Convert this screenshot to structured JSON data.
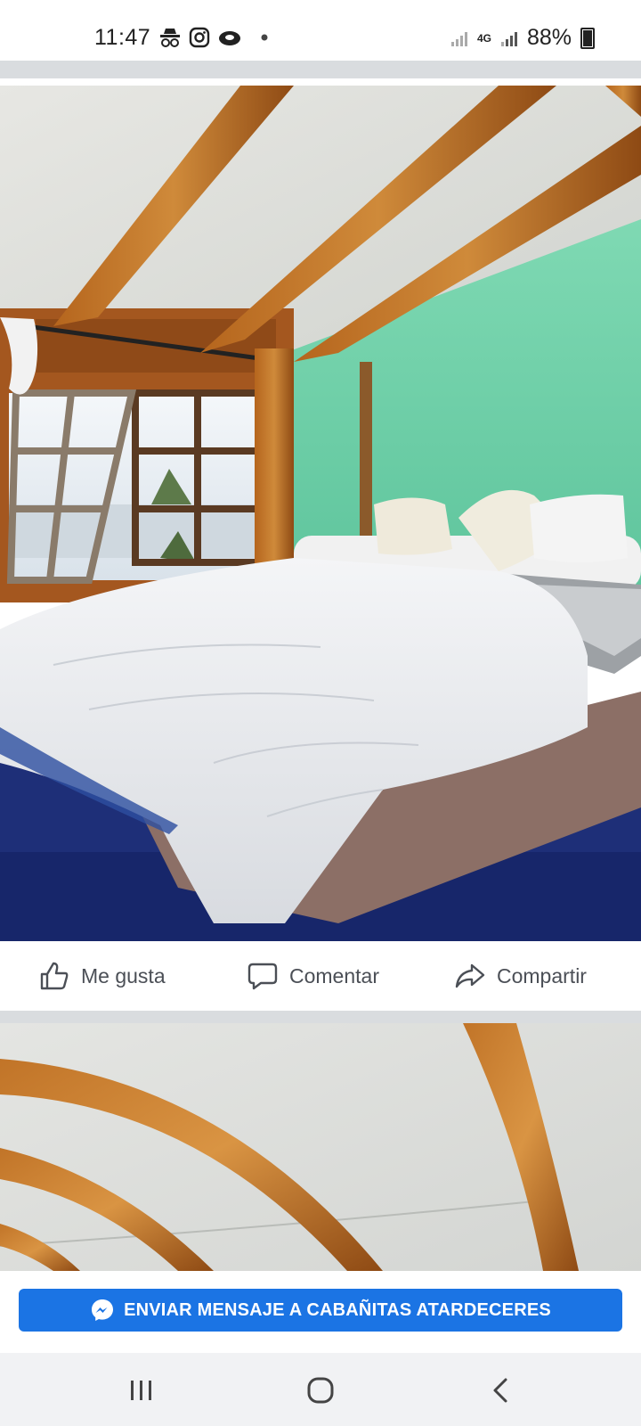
{
  "status_bar": {
    "time": "11:47",
    "network": "4G",
    "battery": "88%",
    "icons": [
      "incognito-icon",
      "instagram-icon",
      "cloud-icon",
      "dot-icon",
      "signal-icon",
      "signal-4g-icon",
      "battery-icon"
    ]
  },
  "actions": {
    "like_label": "Me gusta",
    "comment_label": "Comentar",
    "share_label": "Compartir"
  },
  "cta": {
    "label": "ENVIAR MENSAJE A CABAÑITAS ATARDECERES"
  },
  "nav": {
    "icons": [
      "recent-apps-icon",
      "home-icon",
      "back-icon"
    ]
  },
  "colors": {
    "brand_blue": "#1b74e4",
    "divider": "#d9dcdf",
    "action_text": "#4b4f56"
  }
}
